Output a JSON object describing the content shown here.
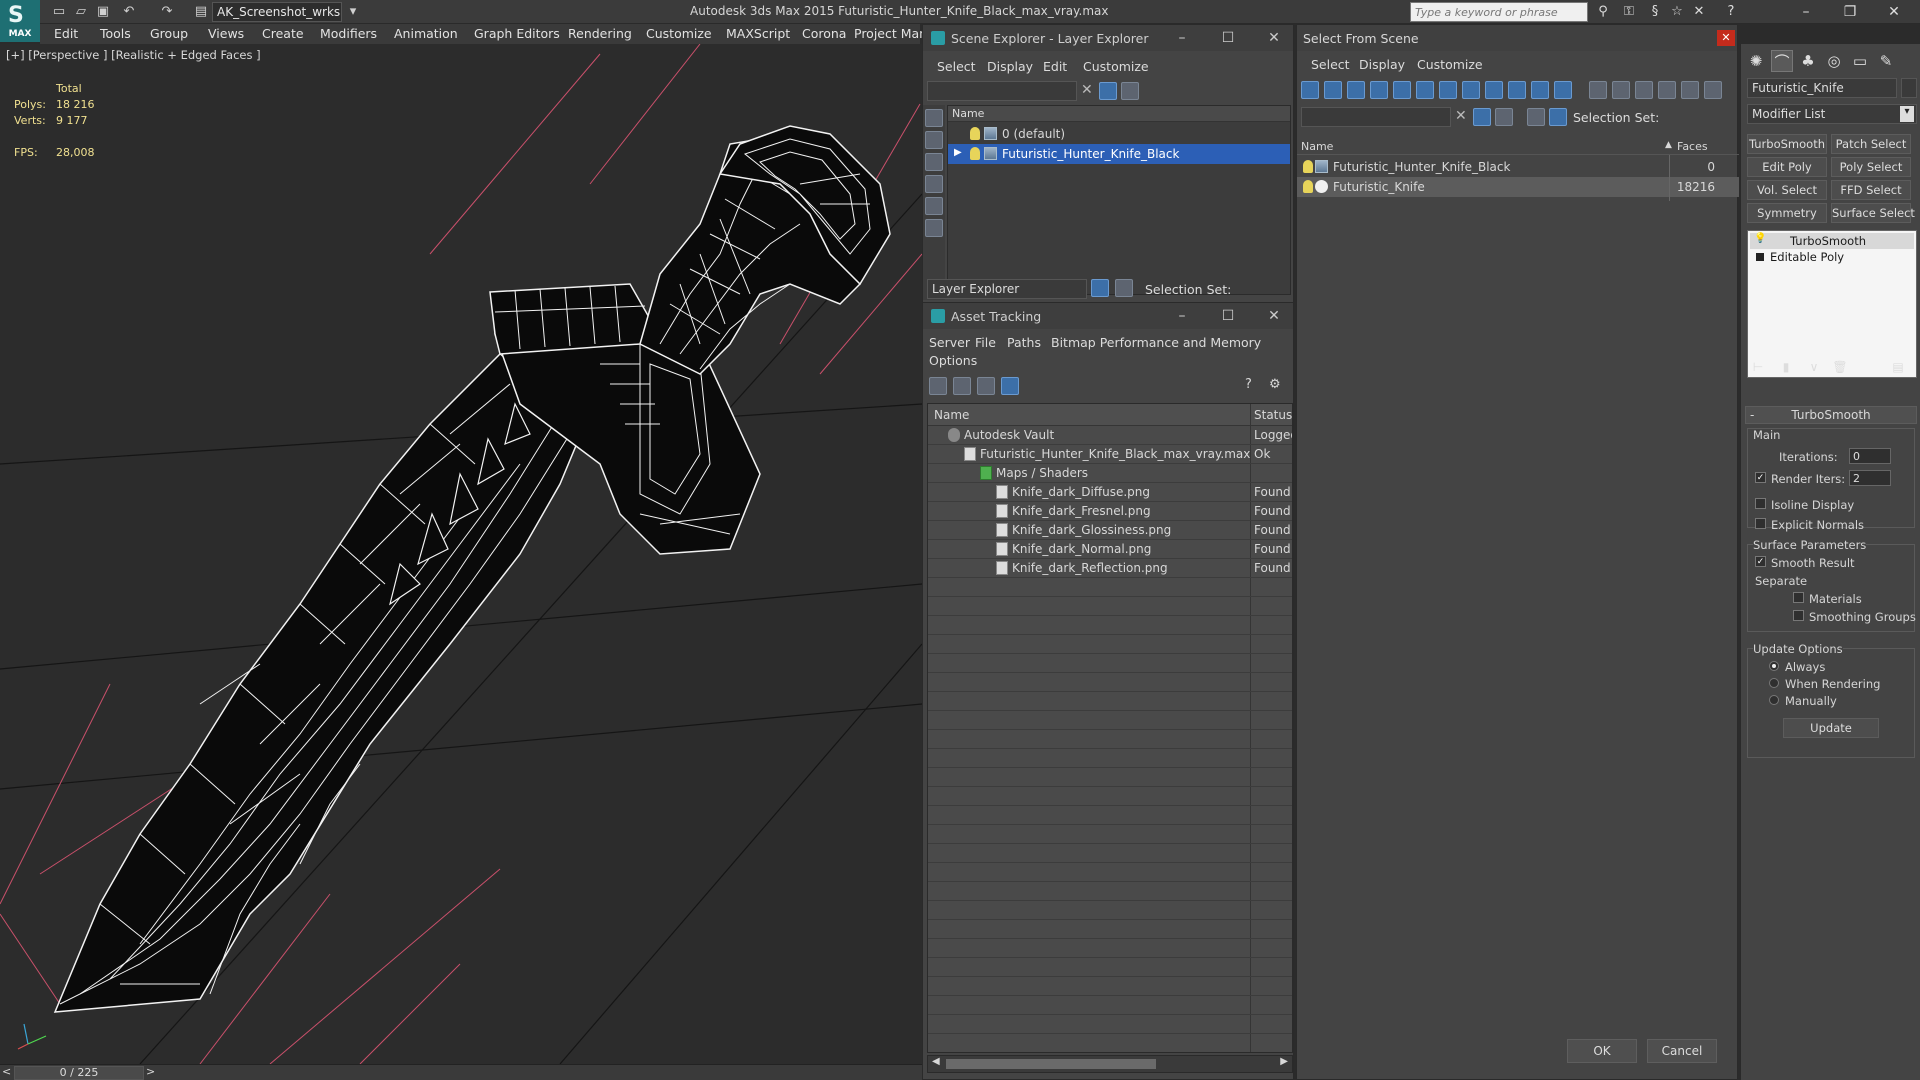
{
  "titlebar": {
    "workspace": "AK_Screenshot_wrksp",
    "window_title": "Autodesk 3ds Max  2015     Futuristic_Hunter_Knife_Black_max_vray.max",
    "search_placeholder": "Type a keyword or phrase",
    "logo_text": "MAX"
  },
  "menu": [
    "Edit",
    "Tools",
    "Group",
    "Views",
    "Create",
    "Modifiers",
    "Animation",
    "Graph Editors",
    "Rendering",
    "Customize",
    "MAXScript",
    "Corona",
    "Project Man"
  ],
  "viewport": {
    "label": "[+] [Perspective ] [Realistic + Edged Faces ]",
    "stats": {
      "total_label": "Total",
      "polys_label": "Polys:",
      "polys": "18 216",
      "verts_label": "Verts:",
      "verts": "9 177",
      "fps_label": "FPS:",
      "fps": "28,008"
    },
    "colors": {
      "background": "#2c2c2c",
      "grid": "#151515",
      "pink": "#c9506b",
      "mesh_fill": "#0a0a0a",
      "wire": "#f2f2f2"
    }
  },
  "timeline": {
    "frame": "0 / 225"
  },
  "scene_explorer": {
    "title": "Scene Explorer - Layer Explorer",
    "menus": [
      "Select",
      "Display",
      "Edit",
      "Customize"
    ],
    "col_name": "Name",
    "rows": [
      {
        "label": "0 (default)",
        "selected": false
      },
      {
        "label": "Futuristic_Hunter_Knife_Black",
        "selected": true
      }
    ],
    "footer_combo": "Layer Explorer",
    "selection_set_label": "Selection Set:"
  },
  "asset_tracking": {
    "title": "Asset Tracking",
    "menus": [
      "Server",
      "File",
      "Paths",
      "Bitmap Performance and Memory"
    ],
    "menu_row2": "Options",
    "col_name": "Name",
    "col_status": "Status",
    "rows": [
      {
        "name": "Autodesk Vault",
        "status": "Logged",
        "indent": 1
      },
      {
        "name": "Futuristic_Hunter_Knife_Black_max_vray.max",
        "status": "Ok",
        "indent": 2
      },
      {
        "name": "Maps / Shaders",
        "status": "",
        "indent": 3
      },
      {
        "name": "Knife_dark_Diffuse.png",
        "status": "Found",
        "indent": 4
      },
      {
        "name": "Knife_dark_Fresnel.png",
        "status": "Found",
        "indent": 4
      },
      {
        "name": "Knife_dark_Glossiness.png",
        "status": "Found",
        "indent": 4
      },
      {
        "name": "Knife_dark_Normal.png",
        "status": "Found",
        "indent": 4
      },
      {
        "name": "Knife_dark_Reflection.png",
        "status": "Found",
        "indent": 4
      }
    ]
  },
  "select_from_scene": {
    "title": "Select From Scene",
    "menus": [
      "Select",
      "Display",
      "Customize"
    ],
    "selection_set_label": "Selection Set:",
    "col_name": "Name",
    "col_faces": "Faces",
    "rows": [
      {
        "name": "Futuristic_Hunter_Knife_Black",
        "faces": "0"
      },
      {
        "name": "Futuristic_Knife",
        "faces": "18216"
      }
    ],
    "ok": "OK",
    "cancel": "Cancel"
  },
  "command_panel": {
    "object_name": "Futuristic_Knife",
    "modifier_list": "Modifier List",
    "buttons": [
      "TurboSmooth",
      "Patch Select",
      "Edit Poly",
      "Poly Select",
      "Vol. Select",
      "FFD Select",
      "Symmetry",
      "Surface Select"
    ],
    "stack": [
      "TurboSmooth",
      "Editable Poly"
    ],
    "rollout_title": "TurboSmooth",
    "main_label": "Main",
    "iterations_label": "Iterations:",
    "iterations": "0",
    "render_iters_label": "Render Iters:",
    "render_iters": "2",
    "isoline": "Isoline Display",
    "explicit_normals": "Explicit Normals",
    "surface_params": "Surface Parameters",
    "smooth_result": "Smooth Result",
    "separate": "Separate",
    "materials": "Materials",
    "smoothing_groups": "Smoothing Groups",
    "update_options": "Update Options",
    "always": "Always",
    "when_rendering": "When Rendering",
    "manually": "Manually",
    "update_button": "Update"
  }
}
